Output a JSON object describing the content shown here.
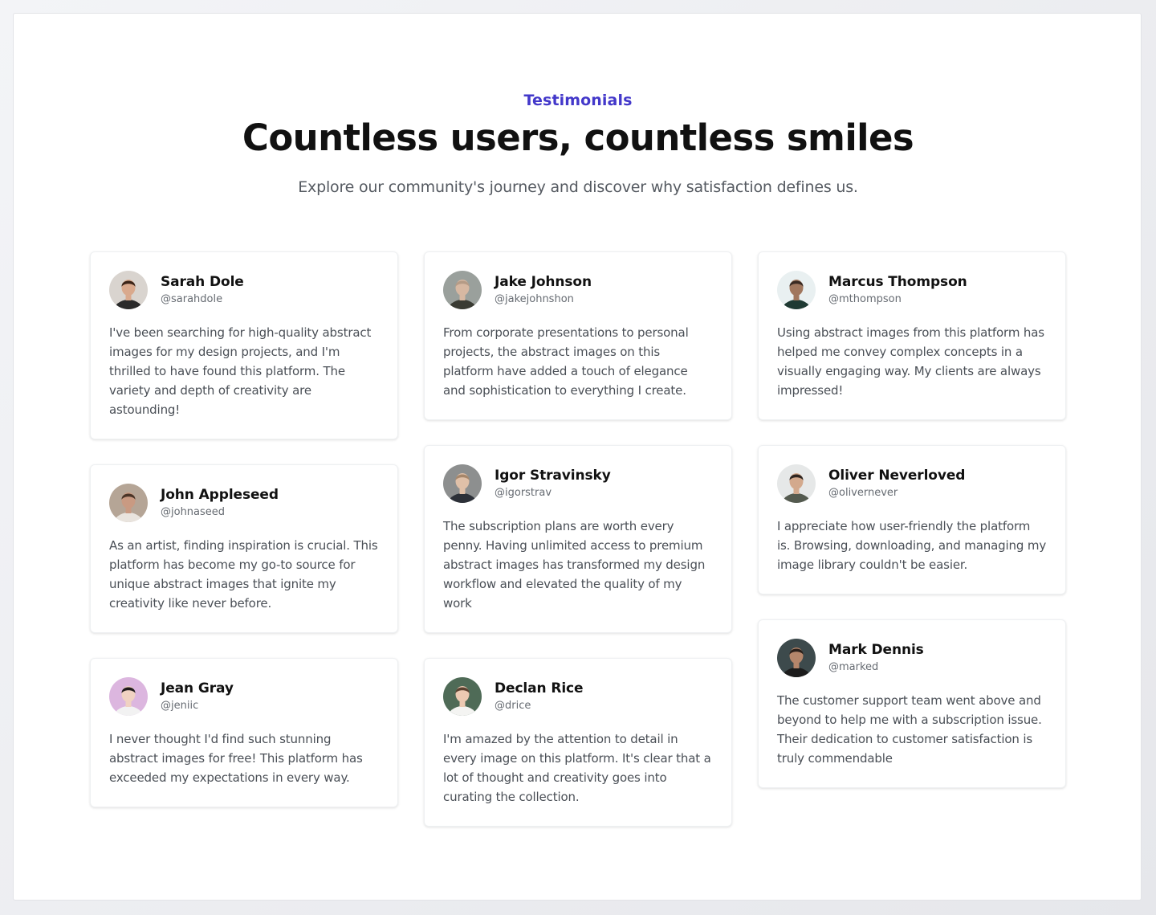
{
  "header": {
    "eyebrow": "Testimonials",
    "title": "Countless users, countless smiles",
    "subtitle": "Explore our community's journey and discover why satisfaction defines us."
  },
  "testimonials": [
    {
      "name": "Sarah Dole",
      "handle": "@sarahdole",
      "text": "I've been searching for high-quality abstract images for my design projects, and I'm thrilled to have found this platform. The variety and depth of creativity are astounding!",
      "avatar_colors": {
        "bg": "#d9d4cf",
        "skin": "#d9a98d",
        "hair": "#3b2418",
        "shirt": "#2a2a2a"
      }
    },
    {
      "name": "Jake Johnson",
      "handle": "@jakejohnshon",
      "text": "From corporate presentations to personal projects, the abstract images on this platform have added a touch of elegance and sophistication to everything I create.",
      "avatar_colors": {
        "bg": "#9aa09c",
        "skin": "#d7b8a2",
        "hair": "#b59b86",
        "shirt": "#3a3b33"
      }
    },
    {
      "name": "Marcus Thompson",
      "handle": "@mthompson",
      "text": "Using abstract images from this platform has helped me convey complex concepts in a visually engaging way. My clients are always impressed!",
      "avatar_colors": {
        "bg": "#e9f0f1",
        "skin": "#a1775e",
        "hair": "#3a2a22",
        "shirt": "#1f3a33"
      }
    },
    {
      "name": "John Appleseed",
      "handle": "@johnaseed",
      "text": "As an artist, finding inspiration is crucial. This platform has become my go-to source for unique abstract images that ignite my creativity like never before.",
      "avatar_colors": {
        "bg": "#b5a596",
        "skin": "#c99a82",
        "hair": "#4a3528",
        "shirt": "#e9e4de"
      }
    },
    {
      "name": "Igor Stravinsky",
      "handle": "@igorstrav",
      "text": "The subscription plans are worth every penny. Having unlimited access to premium abstract images has transformed my design workflow and elevated the quality of my work",
      "avatar_colors": {
        "bg": "#8d8f8f",
        "skin": "#e0c0a8",
        "hair": "#a6866a",
        "shirt": "#2c3038"
      }
    },
    {
      "name": "Oliver Neverloved",
      "handle": "@olivernever",
      "text": "I appreciate how user-friendly the platform is. Browsing, downloading, and managing my image library couldn't be easier.",
      "avatar_colors": {
        "bg": "#e6e8e8",
        "skin": "#d3a98d",
        "hair": "#2e2520",
        "shirt": "#545a4f"
      }
    },
    {
      "name": "Jean Gray",
      "handle": "@jeniic",
      "text": "I never thought I'd find such stunning abstract images for free! This platform has exceeded my expectations in every way.",
      "avatar_colors": {
        "bg": "#dcb6df",
        "skin": "#f0d2c2",
        "hair": "#1f1a1c",
        "shirt": "#f2f2f2"
      }
    },
    {
      "name": "Declan Rice",
      "handle": "@drice",
      "text": "I'm amazed by the attention to detail in every image on this platform. It's clear that a lot of thought and creativity goes into curating the collection.",
      "avatar_colors": {
        "bg": "#4f6b57",
        "skin": "#ecc9b2",
        "hair": "#5b4130",
        "shirt": "#f4f4f2"
      }
    },
    {
      "name": "Mark Dennis",
      "handle": "@marked",
      "text": "The customer support team went above and beyond to help me with a subscription issue. Their dedication to customer satisfaction is truly commendable",
      "avatar_colors": {
        "bg": "#3d4a4c",
        "skin": "#b5866b",
        "hair": "#2a1f1a",
        "shirt": "#1c1c1c"
      }
    }
  ]
}
